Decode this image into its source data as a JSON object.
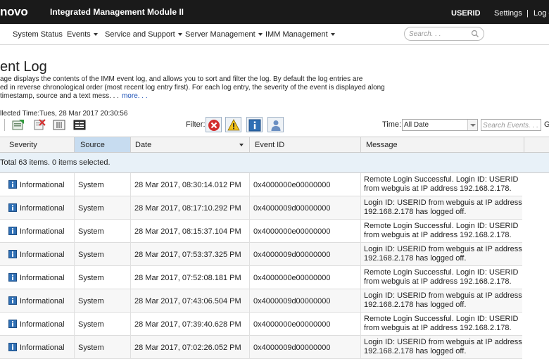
{
  "header": {
    "brand": "novo",
    "product": "Integrated Management Module II",
    "user": "USERID",
    "settings": "Settings",
    "separator": "|",
    "logout": "Log o"
  },
  "nav": {
    "items": [
      {
        "label": "System Status",
        "dropdown": false
      },
      {
        "label": "Events",
        "dropdown": true
      },
      {
        "label": "Service and Support",
        "dropdown": true
      },
      {
        "label": "Server Management",
        "dropdown": true
      },
      {
        "label": "IMM Management",
        "dropdown": true
      }
    ],
    "search_placeholder": "Search. . ."
  },
  "page": {
    "title": "ent Log",
    "description": [
      "age displays the contents of the IMM event log, and allows you to sort and filter the log. By default the log entries are",
      "ed in reverse chronological order (most recent log entry first). For each log entry, the severity of the event is displayed along",
      "timestamp, source and a text mess. . ."
    ],
    "more_link": "more. . .",
    "collected_time": "llected Time:Tues, 28 Mar 2017 20:30:56"
  },
  "toolbar": {
    "filter_label": "Filter:",
    "time_label": "Time:",
    "time_value": "All Date",
    "search_events_placeholder": "Search Events. . .",
    "go_label": "G"
  },
  "table": {
    "columns": [
      "Severity",
      "Source",
      "Date",
      "Event ID",
      "Message"
    ],
    "summary": "Total 63 items. 0 items selected.",
    "rows": [
      {
        "severity": "Informational",
        "source": "System",
        "date": "28 Mar 2017, 08:30:14.012 PM",
        "event_id": "0x4000000e00000000",
        "message_1": "Remote Login Successful. Login ID: USERID",
        "message_2": "from webguis at IP address 192.168.2.178."
      },
      {
        "severity": "Informational",
        "source": "System",
        "date": "28 Mar 2017, 08:17:10.292 PM",
        "event_id": "0x4000009d00000000",
        "message_1": "Login ID: USERID from webguis at IP address",
        "message_2": "192.168.2.178 has logged off."
      },
      {
        "severity": "Informational",
        "source": "System",
        "date": "28 Mar 2017, 08:15:37.104 PM",
        "event_id": "0x4000000e00000000",
        "message_1": "Remote Login Successful. Login ID: USERID",
        "message_2": "from webguis at IP address 192.168.2.178."
      },
      {
        "severity": "Informational",
        "source": "System",
        "date": "28 Mar 2017, 07:53:37.325 PM",
        "event_id": "0x4000009d00000000",
        "message_1": "Login ID: USERID from webguis at IP address",
        "message_2": "192.168.2.178 has logged off."
      },
      {
        "severity": "Informational",
        "source": "System",
        "date": "28 Mar 2017, 07:52:08.181 PM",
        "event_id": "0x4000000e00000000",
        "message_1": "Remote Login Successful. Login ID: USERID",
        "message_2": "from webguis at IP address 192.168.2.178."
      },
      {
        "severity": "Informational",
        "source": "System",
        "date": "28 Mar 2017, 07:43:06.504 PM",
        "event_id": "0x4000009d00000000",
        "message_1": "Login ID: USERID from webguis at IP address",
        "message_2": "192.168.2.178 has logged off."
      },
      {
        "severity": "Informational",
        "source": "System",
        "date": "28 Mar 2017, 07:39:40.628 PM",
        "event_id": "0x4000000e00000000",
        "message_1": "Remote Login Successful. Login ID: USERID",
        "message_2": "from webguis at IP address 192.168.2.178."
      },
      {
        "severity": "Informational",
        "source": "System",
        "date": "28 Mar 2017, 07:02:26.052 PM",
        "event_id": "0x4000009d00000000",
        "message_1": "Login ID: USERID from webguis at IP address",
        "message_2": "192.168.2.178 has logged off."
      }
    ]
  },
  "colors": {
    "topbar_bg": "#1a1a1a",
    "source_header_bg": "#c7dcf0",
    "summary_bg": "#e8f1f8",
    "info_icon": "#2f6fb4",
    "error_icon": "#d22e2e",
    "warning_icon": "#f2c21b"
  },
  "icons": [
    "add-icon",
    "delete-icon",
    "columns-icon",
    "export-icon",
    "error-filter-icon",
    "warning-filter-icon",
    "info-filter-icon",
    "audit-filter-icon",
    "info-icon",
    "search-icon"
  ]
}
